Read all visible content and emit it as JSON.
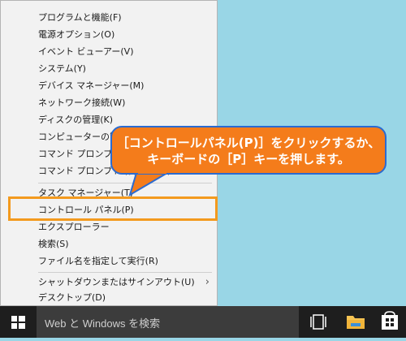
{
  "context_menu": {
    "items": [
      {
        "label": "プログラムと機能(F)"
      },
      {
        "label": "電源オプション(O)"
      },
      {
        "label": "イベント ビューアー(V)"
      },
      {
        "label": "システム(Y)"
      },
      {
        "label": "デバイス マネージャー(M)"
      },
      {
        "label": "ネットワーク接続(W)"
      },
      {
        "label": "ディスクの管理(K)"
      },
      {
        "label": "コンピューターの管理(G)"
      },
      {
        "label": "コマンド プロンプト(C)"
      },
      {
        "label": "コマンド プロンプト (管理者)(A)"
      },
      {
        "label": "タスク マネージャー(T)"
      },
      {
        "label": "コントロール パネル(P)"
      },
      {
        "label": "エクスプローラー"
      },
      {
        "label": "検索(S)"
      },
      {
        "label": "ファイル名を指定して実行(R)"
      },
      {
        "label": "シャットダウンまたはサインアウト(U)"
      },
      {
        "label": "デスクトップ(D)"
      }
    ]
  },
  "callout": {
    "line1": "［コントロールパネル(P)］をクリックするか、",
    "line2": "キーボードの［P］キーを押します。"
  },
  "taskbar": {
    "search_placeholder": "Web と Windows を検索"
  },
  "colors": {
    "desktop": "#99d6e6",
    "callout": "#f47c1b",
    "highlight": "#f39a1e",
    "taskbar": "#1e1e1e"
  }
}
